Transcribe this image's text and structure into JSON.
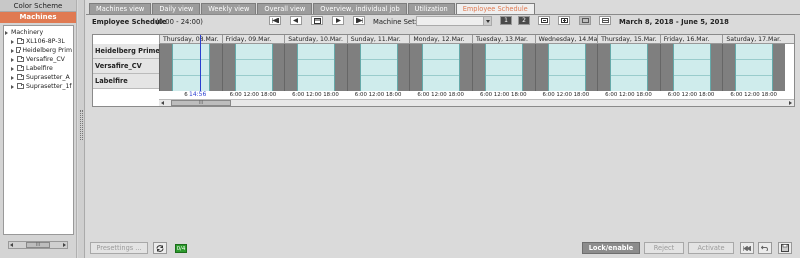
{
  "left": {
    "header": "Color Scheme",
    "subheader": "Machines",
    "tree": {
      "root": "Machinery",
      "children": [
        "XL106-8P-3L",
        "Heidelberg Prim",
        "Versafire_CV",
        "Labelfire",
        "Suprasetter_A",
        "Suprasetter_1f"
      ]
    },
    "scroll_label": "III"
  },
  "tabs": [
    {
      "label": "Machines view"
    },
    {
      "label": "Daily view"
    },
    {
      "label": "Weekly view"
    },
    {
      "label": "Overall view"
    },
    {
      "label": "Overview, individual job"
    },
    {
      "label": "Utilization"
    },
    {
      "label": "Employee Schedule"
    }
  ],
  "active_tab": "Employee Schedule",
  "toolbar": {
    "title": "Employee Schedule",
    "time_range": "(0:00 - 24:00)",
    "machine_set_label": "Machine Set:",
    "machine_set_value": "",
    "btn_1": "1",
    "btn_2": "2",
    "date_range": "March 8, 2018  -  June 5, 2018"
  },
  "gantt": {
    "rows": [
      "Heidelberg Primefire",
      "Versafire_CV",
      "Labelfire"
    ],
    "days": [
      "Thursday, 08.Mar.",
      "Friday, 09.Mar.",
      "Saturday, 10.Mar.",
      "Sunday, 11.Mar.",
      "Monday, 12.Mar.",
      "Tuesday, 13.Mar.",
      "Wednesday, 14.Mar.",
      "Thursday, 15.Mar.",
      "Friday, 16.Mar.",
      "Saturday, 17.Mar."
    ],
    "time_axis": [
      "6:00",
      "6:00   12:00 18:00",
      "6:00   12:00 18:00",
      "6:00   12:00 18:00",
      "6:00   12:00 18:00",
      "6:00   12:00 18:00",
      "6:00   12:00 18:00",
      "6:00   12:00 18:00",
      "6:00   12:00 18:00",
      "6:00   12:00 18:00"
    ],
    "now_label": "14:56",
    "scroll_label": "III"
  },
  "bottom": {
    "presettings": "Presettings ...",
    "badge": "0/4",
    "lock_enable": "Lock/enable",
    "reject": "Reject",
    "activate": "Activate"
  }
}
